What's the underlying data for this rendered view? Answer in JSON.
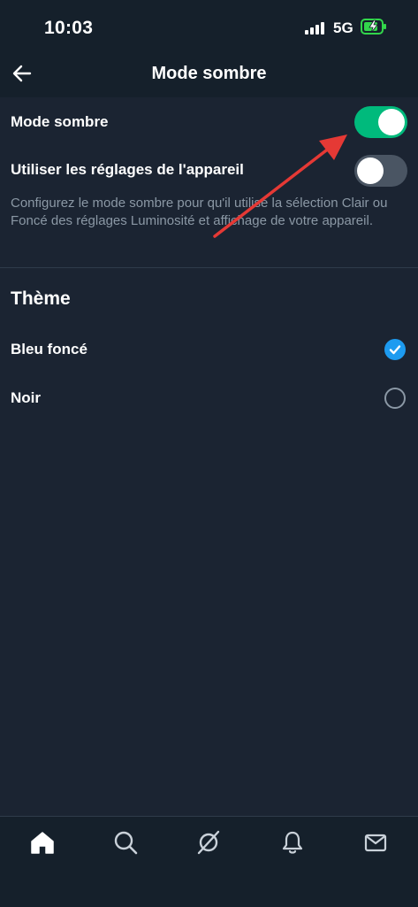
{
  "status": {
    "time": "10:03",
    "network": "5G"
  },
  "header": {
    "title": "Mode sombre"
  },
  "settings": {
    "dark_mode": {
      "label": "Mode sombre",
      "enabled": true
    },
    "use_device": {
      "label": "Utiliser les réglages de l'appareil",
      "enabled": false
    },
    "description": "Configurez le mode sombre pour qu'il utilise la sélection Clair ou Foncé des réglages Luminosité et affichage de votre appareil."
  },
  "theme": {
    "heading": "Thème",
    "options": [
      {
        "label": "Bleu foncé",
        "selected": true
      },
      {
        "label": "Noir",
        "selected": false
      }
    ]
  },
  "tabs": [
    "home-icon",
    "search-icon",
    "communities-icon",
    "notifications-icon",
    "messages-icon"
  ],
  "colors": {
    "toggle_on": "#00ba7c",
    "accent": "#1d9bf0",
    "annotation_arrow": "#e53935"
  }
}
